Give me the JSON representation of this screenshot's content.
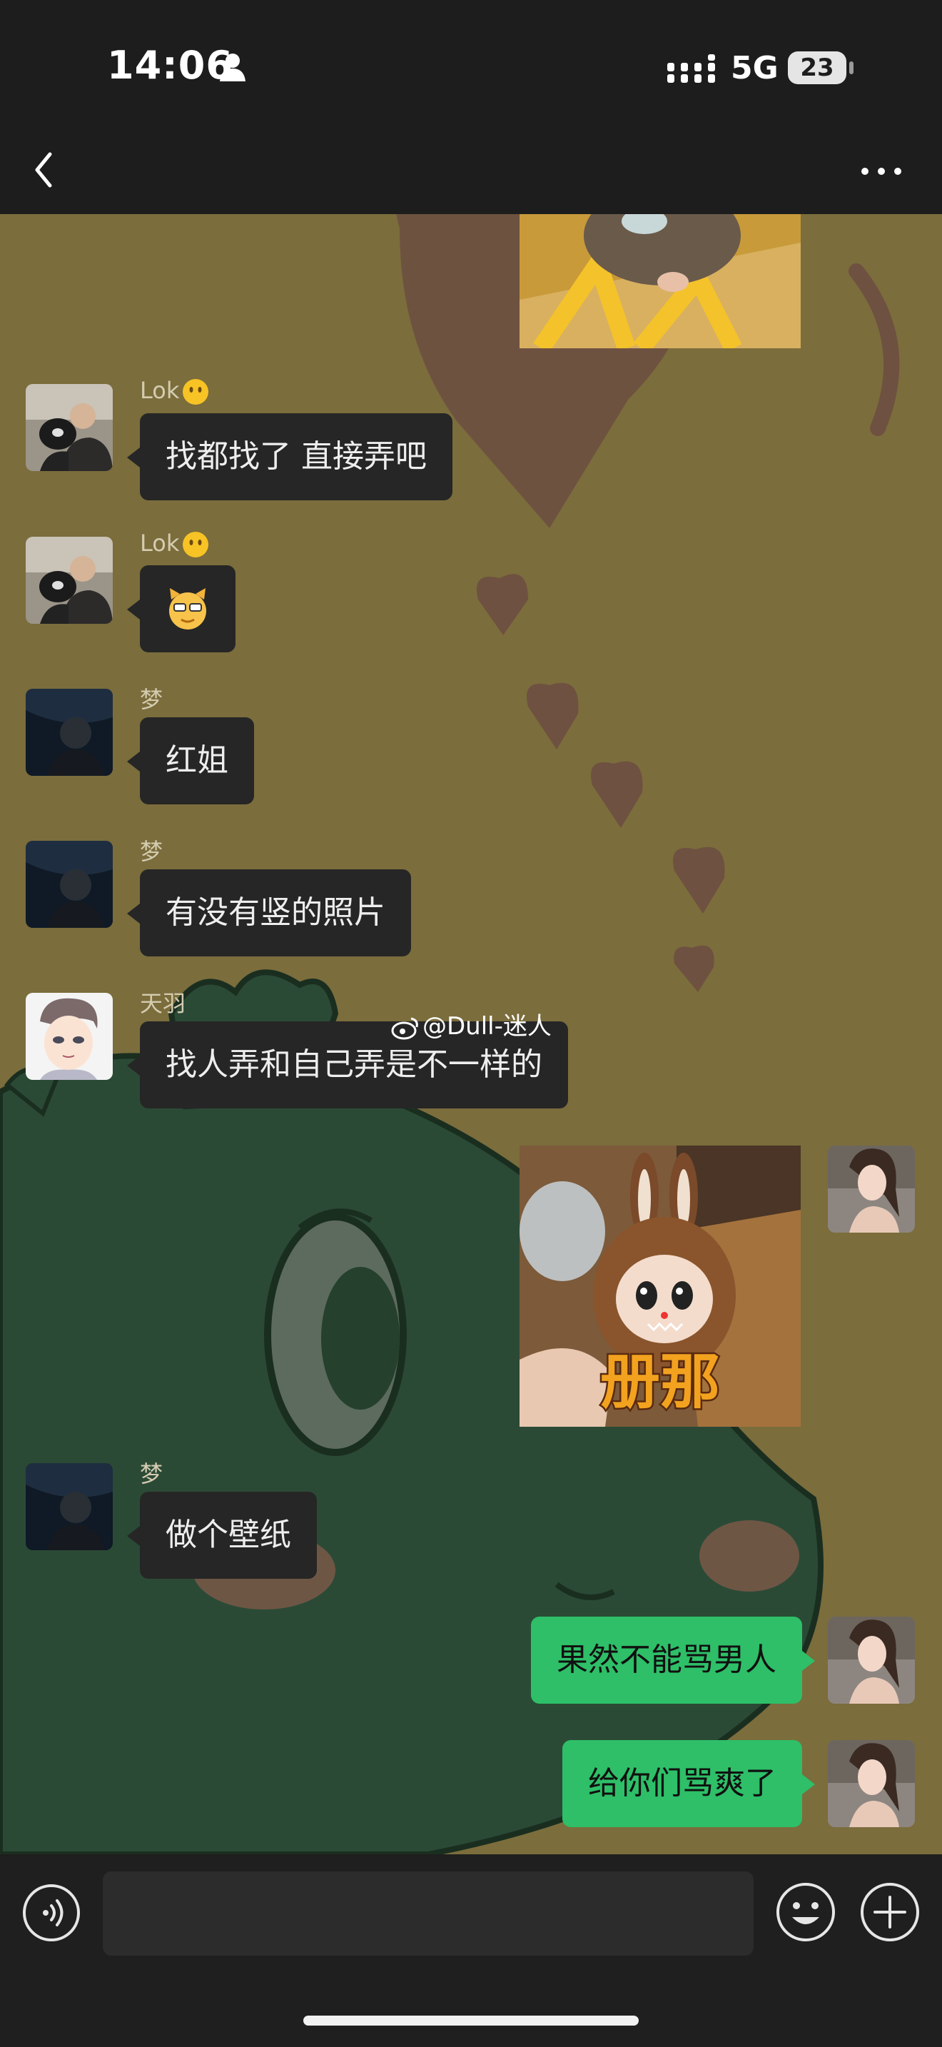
{
  "status_bar": {
    "time": "14:06",
    "network": "5G",
    "battery": "23"
  },
  "nav": {
    "title": ""
  },
  "messages": {
    "m1": {
      "sender": "Lok",
      "text": "找都找了 直接弄吧"
    },
    "m2": {
      "sender": "Lok",
      "emoji": "cat-emoji"
    },
    "m3": {
      "sender": "梦",
      "text": "红姐"
    },
    "m4": {
      "sender": "梦",
      "text": "有没有竖的照片"
    },
    "m5": {
      "sender": "天羽",
      "text": "找人弄和自己弄是不一样的"
    },
    "m6": {
      "sender": "me",
      "image_caption": "册那"
    },
    "m7": {
      "sender": "梦",
      "text": "做个壁纸"
    },
    "m8": {
      "sender": "me",
      "text": "果然不能骂男人"
    },
    "m9": {
      "sender": "me",
      "text": "给你们骂爽了"
    }
  },
  "watermark": "@Dull-迷人",
  "input": {
    "placeholder": ""
  },
  "colors": {
    "outgoing_bubble": "#2ebf68",
    "incoming_bubble": "#262626",
    "wallpaper_olive": "#7b6d3c",
    "wallpaper_green": "#2b4a36"
  }
}
